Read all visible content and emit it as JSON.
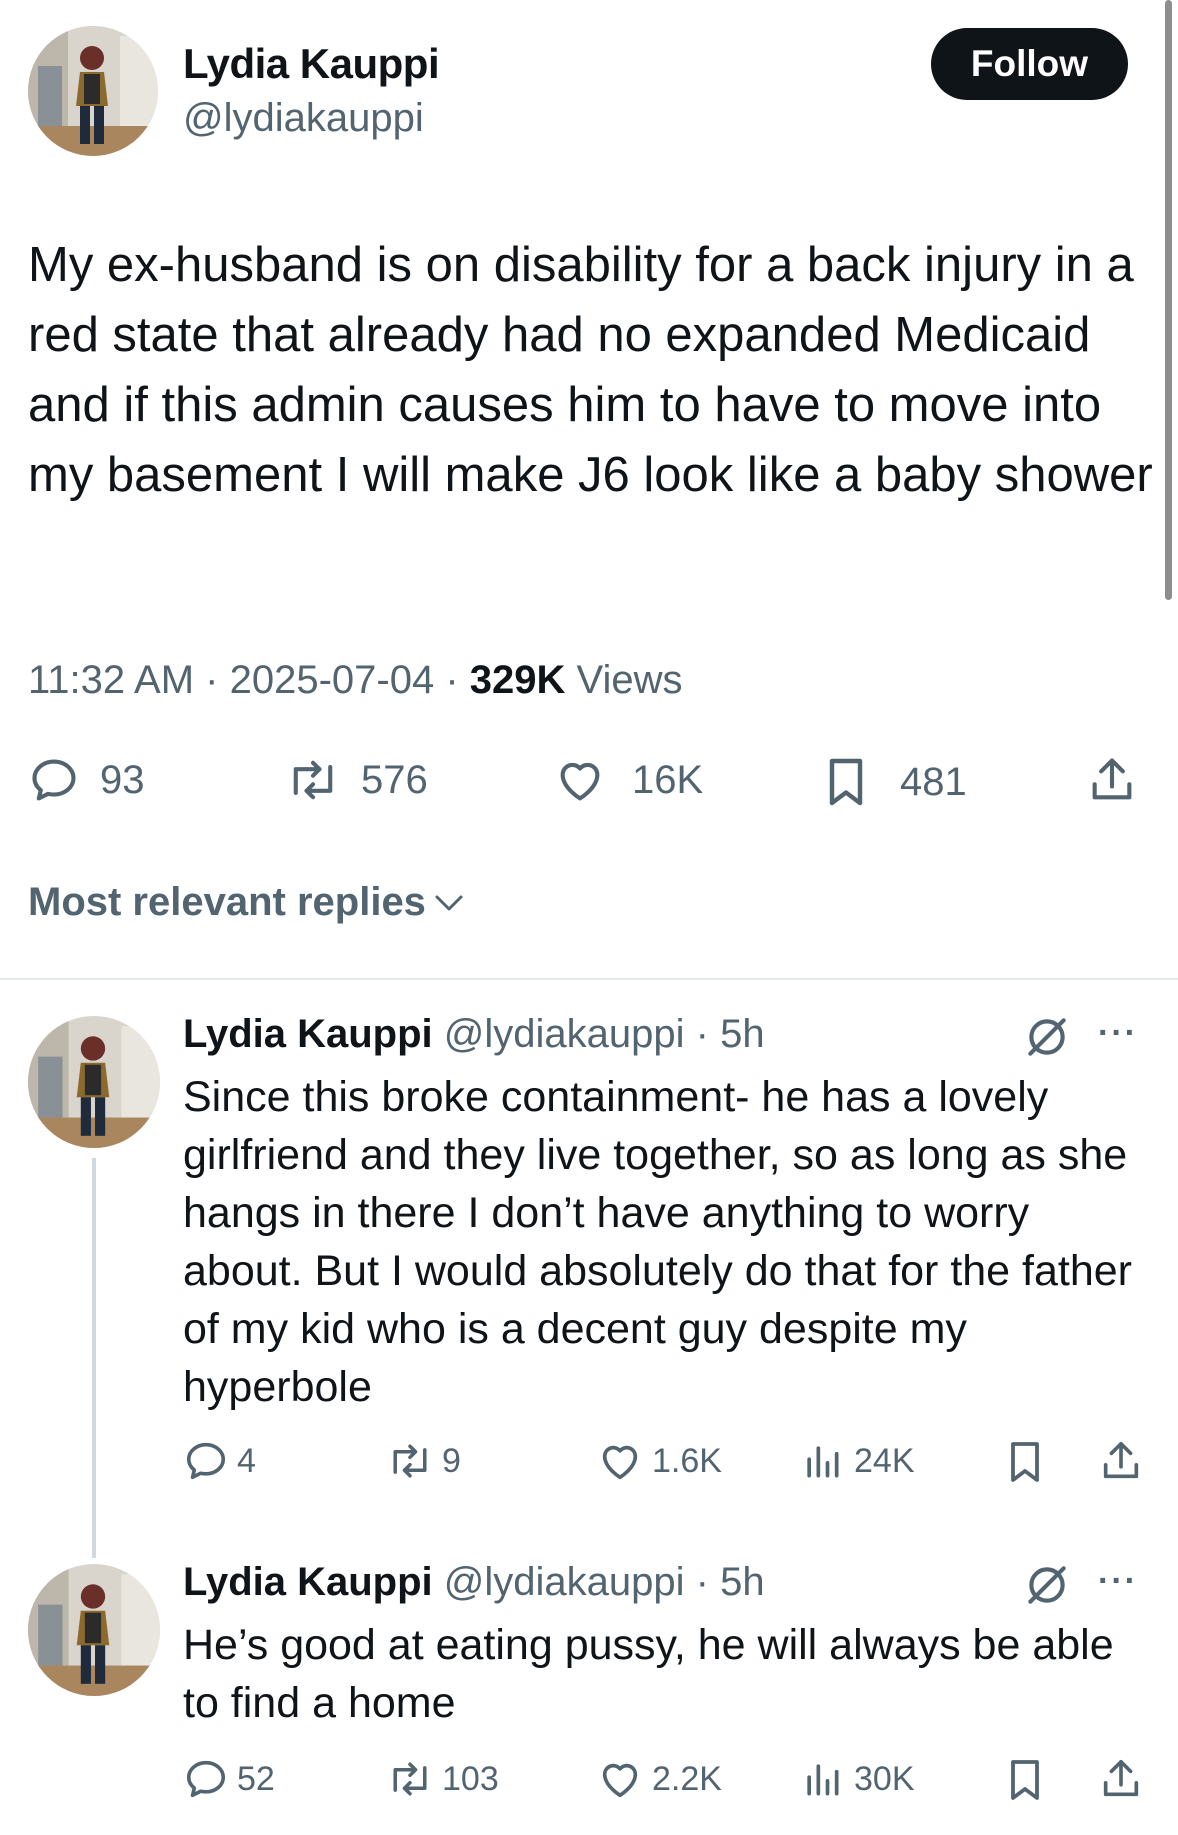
{
  "main_tweet": {
    "author_name": "Lydia Kauppi",
    "author_handle": "@lydiakauppi",
    "follow_label": "Follow",
    "text": "My ex-husband is on disability for a back injury in a red state that already had no expanded Medicaid and if this admin causes him to have to move into my basement I will make J6 look like a baby shower",
    "time": "11:32 AM",
    "date": "2025-07-04",
    "views_count": "329K",
    "views_label": "Views",
    "separator": " · ",
    "stats": {
      "replies": "93",
      "reposts": "576",
      "likes": "16K",
      "bookmarks": "481"
    }
  },
  "replies_sort": {
    "label": "Most relevant replies"
  },
  "replies": [
    {
      "author_name": "Lydia Kauppi",
      "author_handle": "@lydiakauppi",
      "time": "· 5h",
      "more": "···",
      "text": "Since this broke containment- he has a lovely girlfriend and they live together, so as long as she hangs in there I don’t have anything to worry about. But I would absolutely do that for the father of my kid who is a decent guy despite my hyperbole",
      "stats": {
        "replies": "4",
        "reposts": "9",
        "likes": "1.6K",
        "views": "24K"
      }
    },
    {
      "author_name": "Lydia Kauppi",
      "author_handle": "@lydiakauppi",
      "time": "· 5h",
      "more": "···",
      "text": "He’s good at eating pussy, he will always be able to find a home",
      "stats": {
        "replies": "52",
        "reposts": "103",
        "likes": "2.2K",
        "views": "30K"
      }
    }
  ],
  "colors": {
    "text_primary": "#0f1419",
    "text_secondary": "#536471",
    "follow_bg": "#0f1419",
    "divider": "#e6e9ea",
    "thread_line": "#cfd9de"
  },
  "icons": [
    "reply-icon",
    "repost-icon",
    "like-icon",
    "bookmark-icon",
    "share-icon",
    "views-icon",
    "grok-icon",
    "chevron-down-icon",
    "more-icon"
  ]
}
